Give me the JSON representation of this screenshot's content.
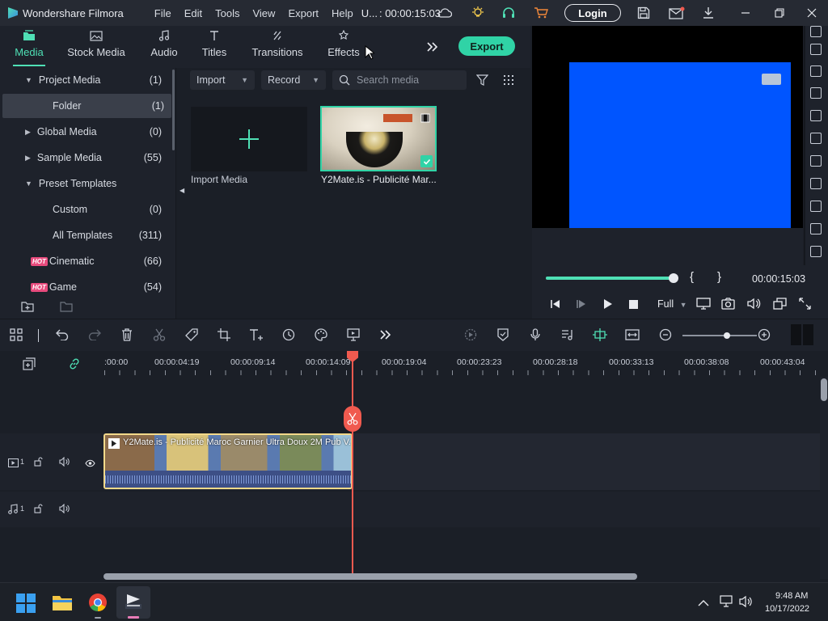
{
  "window": {
    "app_name": "Wondershare Filmora",
    "menu": [
      "File",
      "Edit",
      "Tools",
      "View",
      "Export",
      "Help"
    ],
    "project_name": "U...",
    "timecode": ": 00:00:15:03",
    "login_label": "Login"
  },
  "media_tabs": [
    {
      "label": "Media",
      "icon": "folder-stack-icon",
      "active": true
    },
    {
      "label": "Stock Media",
      "icon": "image-icon"
    },
    {
      "label": "Audio",
      "icon": "music-note-icon"
    },
    {
      "label": "Titles",
      "icon": "text-t-icon"
    },
    {
      "label": "Transitions",
      "icon": "transition-icon"
    },
    {
      "label": "Effects",
      "icon": "effects-icon"
    }
  ],
  "export_label": "Export",
  "library_tree": [
    {
      "label": "Project Media",
      "count": "(1)",
      "caret": "down"
    },
    {
      "label": "Folder",
      "count": "(1)",
      "selected": true
    },
    {
      "label": "Global Media",
      "count": "(0)",
      "caret": "right"
    },
    {
      "label": "Sample Media",
      "count": "(55)",
      "caret": "right"
    },
    {
      "label": "Preset Templates",
      "count": "",
      "caret": "down"
    },
    {
      "label": "Custom",
      "count": "(0)"
    },
    {
      "label": "All Templates",
      "count": "(311)"
    },
    {
      "label": "Cinematic",
      "count": "(66)",
      "badge": "HOT"
    },
    {
      "label": "Game",
      "count": "(54)",
      "badge": "HOT"
    }
  ],
  "media_toolbar": {
    "import_label": "Import",
    "record_label": "Record",
    "search_placeholder": "Search media"
  },
  "media_items": {
    "import_tile_label": "Import Media",
    "clip_label": "Y2Mate.is - Publicité Mar..."
  },
  "preview": {
    "timecode": "00:00:15:03",
    "quality": "Full",
    "progress": 1.0,
    "bracket_in": "{",
    "bracket_out": "}"
  },
  "ruler_ticks": [
    ":00:00",
    "00:00:04:19",
    "00:00:09:14",
    "00:00:14:09",
    "00:00:19:04",
    "00:00:23:23",
    "00:00:28:18",
    "00:00:33:13",
    "00:00:38:08",
    "00:00:43:04"
  ],
  "timeline": {
    "video_track_num": "1",
    "audio_track_num": "1",
    "clip_title": "Y2Mate.is - Publicité Maroc Garnier Ultra Doux 2M Pub V...",
    "zoom_level": 0.6
  },
  "taskbar": {
    "time": "9:48 AM",
    "date": "10/17/2022"
  },
  "colors": {
    "accent": "#30d3a6",
    "playhead": "#f05a4f",
    "preview_blue": "#0055ff",
    "clip_border": "#f3d98a"
  }
}
